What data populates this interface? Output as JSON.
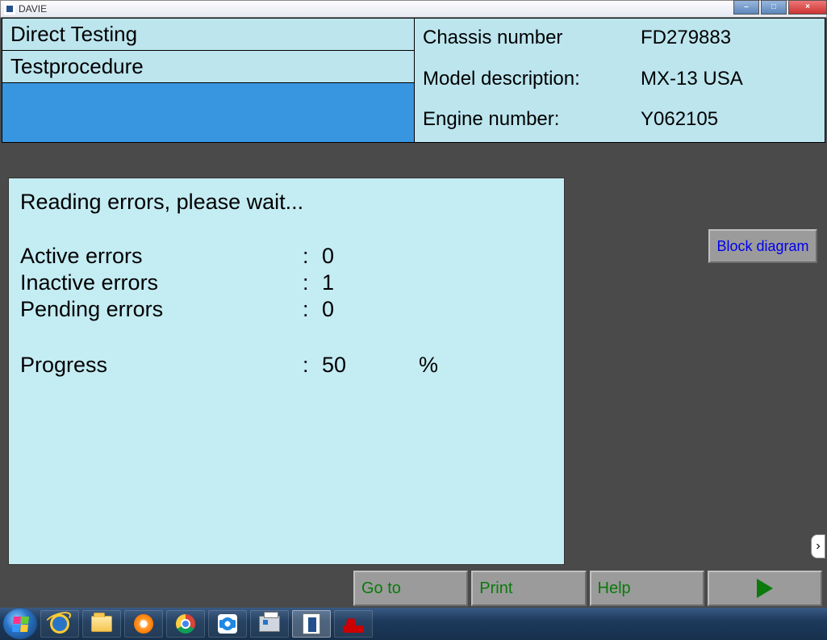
{
  "window": {
    "title": "DAVIE"
  },
  "window_controls": {
    "min": "–",
    "max": "□",
    "close": "×"
  },
  "left": {
    "heading": "Direct Testing",
    "subheading": "Testprocedure"
  },
  "vehicle": {
    "chassis_label": "Chassis number",
    "chassis_value": "FD279883",
    "model_label": "Model description:",
    "model_value": "MX-13 USA",
    "engine_label": "Engine number:",
    "engine_value": "Y062105"
  },
  "status": {
    "title": "Reading errors, please wait...",
    "rows": {
      "active": {
        "label": "Active errors",
        "value": "0"
      },
      "inactive": {
        "label": "Inactive errors",
        "value": "1"
      },
      "pending": {
        "label": "Pending errors",
        "value": "0"
      },
      "progress": {
        "label": "Progress",
        "value": "50",
        "unit": "%"
      }
    }
  },
  "buttons": {
    "block_diagram": "Block diagram",
    "goto": "Go to",
    "print": "Print",
    "help": "Help"
  },
  "side_tab_glyph": "›"
}
